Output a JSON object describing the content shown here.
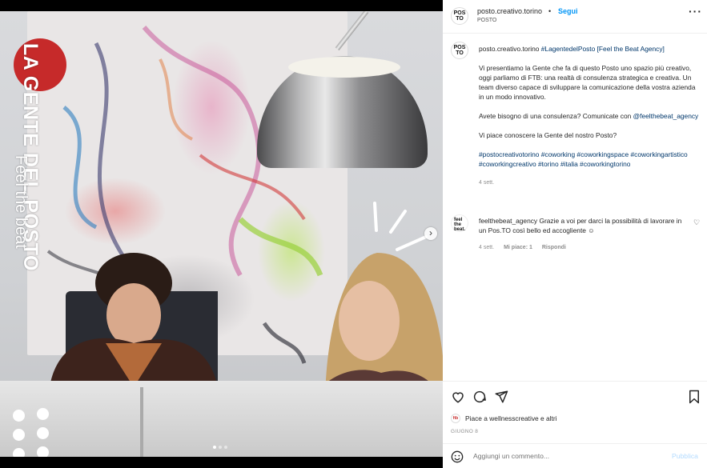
{
  "post": {
    "overlay_title": "LA GENTE DEL POSTO",
    "overlay_subtitle": "Feel the beat",
    "next_icon": "chevron-right-icon"
  },
  "header": {
    "avatar_text": "POS TO",
    "username": "posto.creativo.torino",
    "separator": "•",
    "follow_label": "Segui",
    "location": "POSTO",
    "more_icon": "more-horizontal-icon",
    "more_label": "···"
  },
  "caption": {
    "username": "posto.creativo.torino",
    "headline": "#LagentedelPosto [Feel the Beat Agency]",
    "paragraph1": "Vi presentiamo la Gente che fa di questo Posto uno spazio più creativo, oggi parliamo di FTB: una realtà di consulenza strategica e creativa. Un team diverso capace di sviluppare la comunicazione della vostra azienda in un modo innovativo.",
    "paragraph2_text": "Avete bisogno di una consulenza? Comunicate con",
    "paragraph2_mention": "@feelthebeat_agency",
    "paragraph3": "Vi piace conoscere la Gente del nostro Posto?",
    "hashtags": "#postocreativotorino #coworking #coworkingspace #coworkingartistico #coworkingcreativo #torino #italia #coworkingtorino",
    "time": "4 sett."
  },
  "comment": {
    "avatar_text": "feel the beat.",
    "username": "feelthebeat_agency",
    "text": "Grazie a voi per darci la possibilità di lavorare in un Pos.TO così bello ed accogliente ☺",
    "time": "4 sett.",
    "likes": "Mi piace: 1",
    "reply": "Rispondi",
    "heart_icon": "heart-outline-icon",
    "heart_glyph": "♡"
  },
  "actions": {
    "like_icon": "heart-outline-icon",
    "comment_icon": "comment-bubble-icon",
    "share_icon": "paper-plane-icon",
    "save_icon": "bookmark-icon",
    "likes_text": "Piace a wellnesscreative e altri",
    "likes_avatar": "ftb",
    "date": "GIUGNO 8"
  },
  "add_comment": {
    "emoji_icon": "smiley-icon",
    "placeholder": "Aggiungi un commento...",
    "publish_label": "Pubblica"
  },
  "colors": {
    "accent_blue": "#0095f6",
    "hashtag_blue": "#00376b",
    "brand_red": "#c62a2a",
    "publish_disabled": "#b3dbff"
  }
}
